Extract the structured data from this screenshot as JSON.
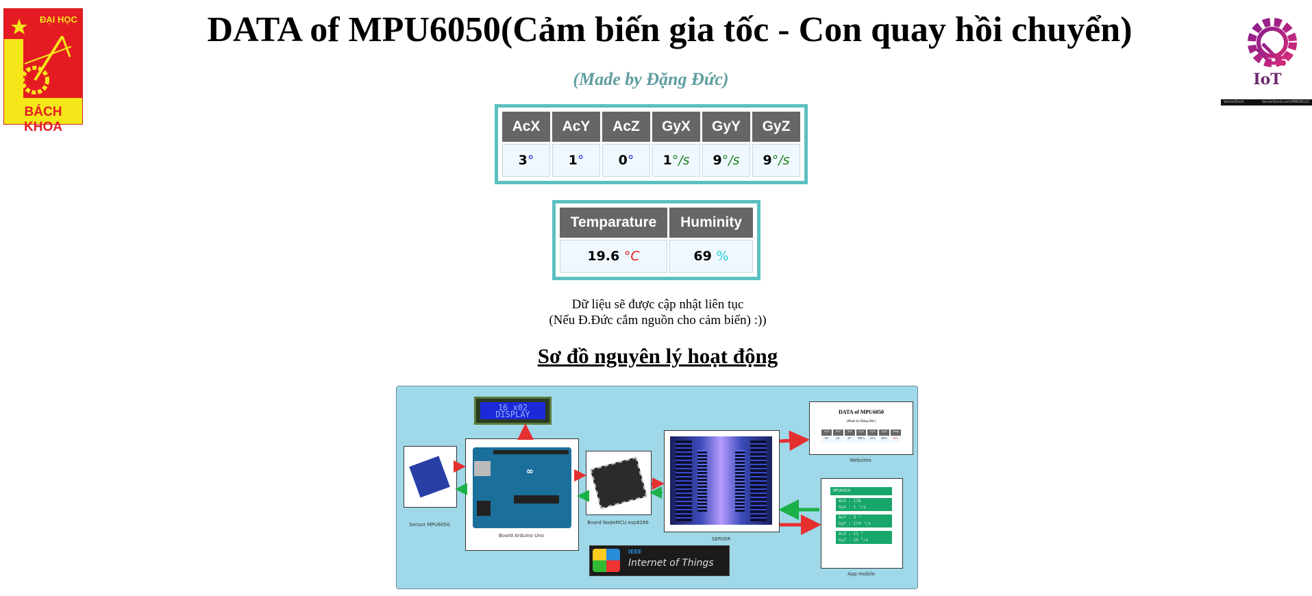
{
  "header": {
    "title": "DATA of MPU6050(Cảm biến gia tốc - Con quay hồi chuyển)",
    "subtitle": "(Made by Đặng Đức)"
  },
  "logos": {
    "left": {
      "line1": "ĐẠI HỌC",
      "line2": "BÁCH KHOA",
      "colors": {
        "red": "#e41b22",
        "yellow": "#f5e71a"
      }
    },
    "right": {
      "text": "IoT",
      "color": "#8b2a8c",
      "strip_left": "VectorStock",
      "strip_right": "VectorStock.com/46838122"
    }
  },
  "mpu_table": {
    "headers": [
      "AcX",
      "AcY",
      "AcZ",
      "GyX",
      "GyY",
      "GyZ"
    ],
    "values": [
      "3",
      "1",
      "0",
      "1",
      "9",
      "9"
    ],
    "units": [
      "°",
      "°",
      "°",
      "°/s",
      "°/s",
      "°/s"
    ]
  },
  "env_table": {
    "headers": [
      "Temparature",
      "Huminity"
    ],
    "values": [
      "19.6",
      "69"
    ],
    "units": [
      "°C",
      "%"
    ]
  },
  "notes": {
    "line1": "Dữ liệu sẽ được cập nhật liên tục",
    "line2": "(Nếu Đ.Đức cắm nguồn cho cảm biến) :))"
  },
  "section": {
    "title": "Sơ đồ nguyên lý hoạt động"
  },
  "diagram": {
    "background": "#9fd8e8",
    "lcd": {
      "line1": "16 x02",
      "line2": "DISPLAY"
    },
    "captions": {
      "sensor": "Sensor MPU6050",
      "arduino": "Board Arduino Uno",
      "nodemcu": "Board NodeMCU esp8266",
      "server": "SERVER",
      "website": "Websites",
      "app": "App mobile",
      "ieee": "IEEE",
      "iot": "Internet of Things"
    },
    "mini_website": {
      "title": "DATA of MPU6050",
      "subtitle": "(Made by Đặng Đức)",
      "headers": [
        "AcX",
        "AcY",
        "AcZ",
        "GyX",
        "GyY",
        "GyZ",
        "Temp"
      ],
      "values": [
        "16°",
        "22°",
        "47°",
        "999°/s",
        "23°/s",
        "80°/s",
        "66°C"
      ]
    },
    "mini_app": {
      "title": "MPU6050",
      "rows": [
        "AcX : 176",
        "GyX : 1 °/s",
        "AcY : 3 °",
        "GyY : 174 °/s",
        "AcZ : 11 °",
        "GyZ : 24 °/s"
      ]
    },
    "arrows": {
      "red": "#e53030",
      "green": "#1bb048"
    }
  }
}
